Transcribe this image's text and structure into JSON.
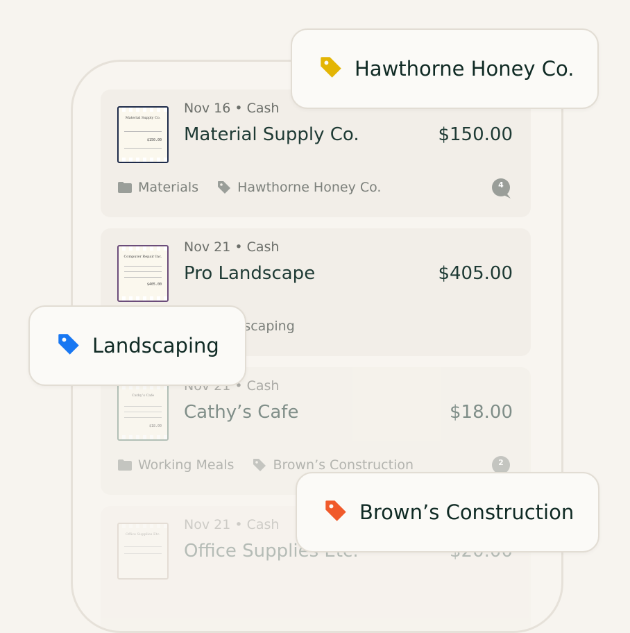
{
  "transactions": [
    {
      "date_method": "Nov 16 • Cash",
      "merchant": "Material Supply Co.",
      "amount": "$150.00",
      "category": "Materials",
      "tag": "Hawthorne Honey Co.",
      "comments": "4",
      "receipt": {
        "title": "Material Supply Co.",
        "total": "$150.00",
        "accent": "#1e2b4a"
      }
    },
    {
      "date_method": "Nov 21 • Cash",
      "merchant": "Pro Landscape",
      "amount": "$405.00",
      "category": "",
      "tag": "Landscaping",
      "comments": "",
      "receipt": {
        "title": "Computer Repair Inc.",
        "total": "$405.00",
        "accent": "#6b4c7a"
      }
    },
    {
      "date_method": "Nov 21 • Cash",
      "merchant": "Cathy’s Cafe",
      "amount": "$18.00",
      "category": "Working Meals",
      "tag": "Brown’s Construction",
      "comments": "2",
      "receipt": {
        "title": "Cathy’s Cafe",
        "total": "$18.00",
        "accent": "#7a9488"
      }
    },
    {
      "date_method": "Nov 21 • Cash",
      "merchant": "Office Supplies Etc.",
      "amount": "$20.00",
      "category": "",
      "tag": "",
      "comments": "",
      "receipt": {
        "title": "Office Supplies Etc.",
        "total": "",
        "accent": "#b9a99a"
      }
    }
  ],
  "chips": [
    {
      "label": "Hawthorne Honey Co.",
      "color": "#e3b505",
      "icon": "tag-icon"
    },
    {
      "label": "Landscaping",
      "color": "#1877f2",
      "icon": "tag-icon"
    },
    {
      "label": "Brown’s Construction",
      "color": "#f05a2b",
      "icon": "tag-icon"
    }
  ]
}
